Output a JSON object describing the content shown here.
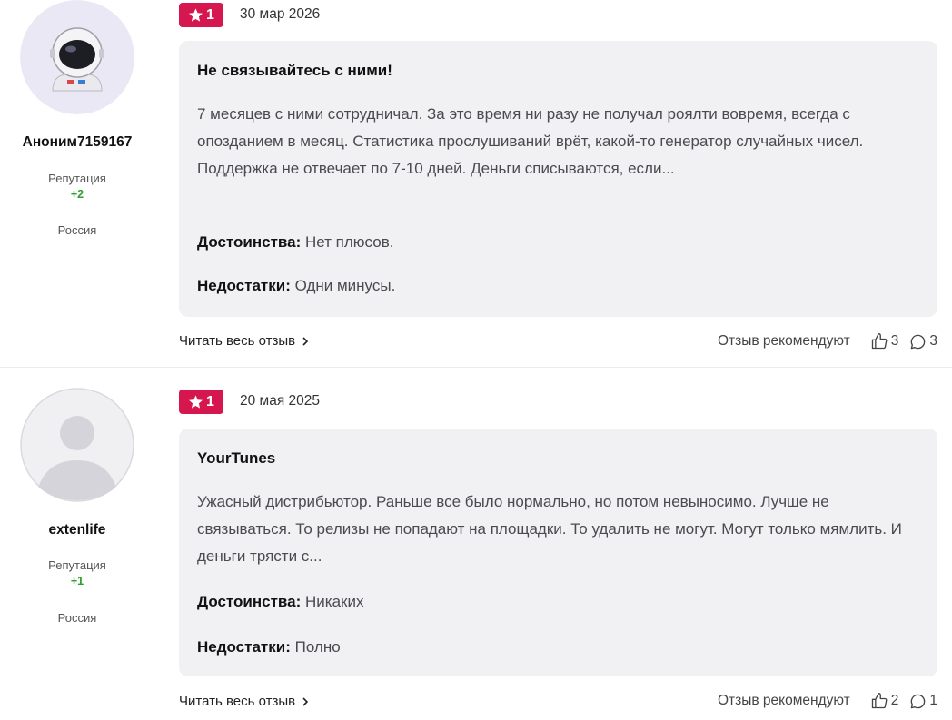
{
  "reviews": [
    {
      "author": "Аноним7159167",
      "avatar": "astronaut-avatar",
      "reputation_label": "Репутация",
      "reputation_value": "+2",
      "country": "Россия",
      "rating": "1",
      "date": "30 мар 2026",
      "title": "Не связывайтесь с ними!",
      "body": "7 месяцев с ними сотрудничал. За это время ни разу не получал роялти вовремя, всегда с опозданием в месяц. Статистика прослушиваний врёт, какой-то генератор случайных чисел. Поддержка не отвечает по 7-10 дней. Деньги списываются, если...",
      "pros_label": "Достоинства:",
      "pros": "Нет плюсов.",
      "cons_label": "Недостатки:",
      "cons": "Одни минусы.",
      "read_more": "Читать весь отзыв",
      "recommend_label": "Отзыв рекомендуют",
      "likes": "3",
      "comments": "3"
    },
    {
      "author": "extenlife",
      "avatar": "default-user-avatar",
      "reputation_label": "Репутация",
      "reputation_value": "+1",
      "country": "Россия",
      "rating": "1",
      "date": "20 мая 2025",
      "title": "YourTunes",
      "body": "Ужасный дистрибьютор. Раньше все было нормально, но потом невыносимо. Лучше не связываться. То релизы не попадают на площадки. То удалить не могут. Могут только мямлить. И деньги трясти с...",
      "pros_label": "Достоинства:",
      "pros": "Никаких",
      "cons_label": "Недостатки:",
      "cons": "Полно",
      "read_more": "Читать весь отзыв",
      "recommend_label": "Отзыв рекомендуют",
      "likes": "2",
      "comments": "1"
    }
  ],
  "colors": {
    "rating_badge": "#d6174f",
    "reputation": "#2e9e2e",
    "card_background": "#f1f1f4"
  }
}
